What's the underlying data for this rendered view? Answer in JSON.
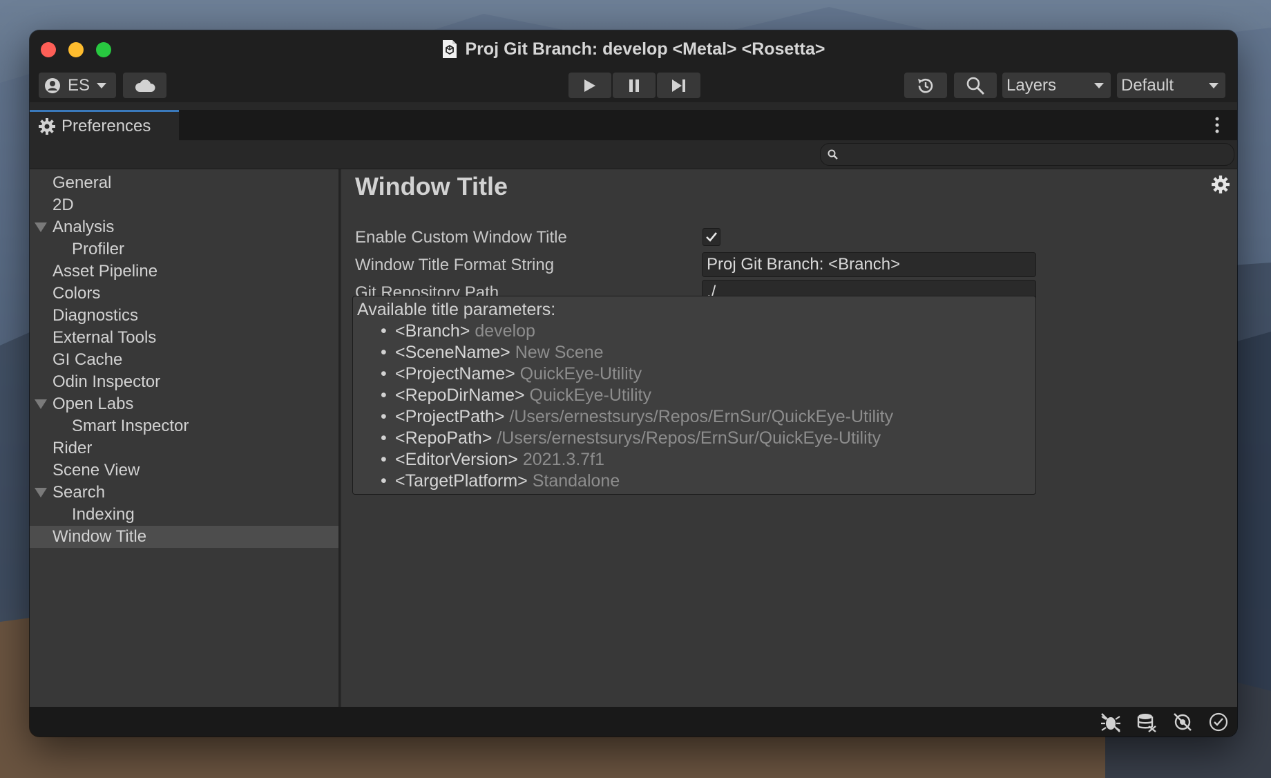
{
  "window": {
    "title": "Proj Git Branch: develop <Metal> <Rosetta>"
  },
  "toolbar": {
    "account_label": "ES",
    "layers_label": "Layers",
    "layout_label": "Default",
    "icons": [
      "account-icon",
      "cloud-icon",
      "play-icon",
      "pause-icon",
      "step-icon",
      "history-icon",
      "search-icon"
    ]
  },
  "tab": {
    "label": "Preferences"
  },
  "sidebar": {
    "items": [
      {
        "label": "General"
      },
      {
        "label": "2D"
      },
      {
        "label": "Analysis"
      },
      {
        "label": "Profiler"
      },
      {
        "label": "Asset Pipeline"
      },
      {
        "label": "Colors"
      },
      {
        "label": "Diagnostics"
      },
      {
        "label": "External Tools"
      },
      {
        "label": "GI Cache"
      },
      {
        "label": "Odin Inspector"
      },
      {
        "label": "Open Labs"
      },
      {
        "label": "Smart Inspector"
      },
      {
        "label": "Rider"
      },
      {
        "label": "Scene View"
      },
      {
        "label": "Search"
      },
      {
        "label": "Indexing"
      },
      {
        "label": "Window Title"
      }
    ],
    "selected": "Window Title"
  },
  "content": {
    "heading": "Window Title",
    "enable_label": "Enable Custom Window Title",
    "enable_checked": true,
    "format_label": "Window Title Format String",
    "format_value": "Proj Git Branch: <Branch>",
    "repo_label": "Git Repository Path",
    "repo_value": "./",
    "help_title": "Available title parameters:",
    "params": [
      {
        "key": "<Branch>",
        "value": "develop"
      },
      {
        "key": "<SceneName>",
        "value": "New Scene"
      },
      {
        "key": "<ProjectName>",
        "value": "QuickEye-Utility"
      },
      {
        "key": "<RepoDirName>",
        "value": "QuickEye-Utility"
      },
      {
        "key": "<ProjectPath>",
        "value": "/Users/ernestsurys/Repos/ErnSur/QuickEye-Utility"
      },
      {
        "key": "<RepoPath>",
        "value": "/Users/ernestsurys/Repos/ErnSur/QuickEye-Utility"
      },
      {
        "key": "<EditorVersion>",
        "value": "2021.3.7f1"
      },
      {
        "key": "<TargetPlatform>",
        "value": "Standalone"
      }
    ]
  },
  "colors": {
    "accent": "#3a79bb",
    "panel": "#383838",
    "selected_row": "#4d4d4d"
  }
}
